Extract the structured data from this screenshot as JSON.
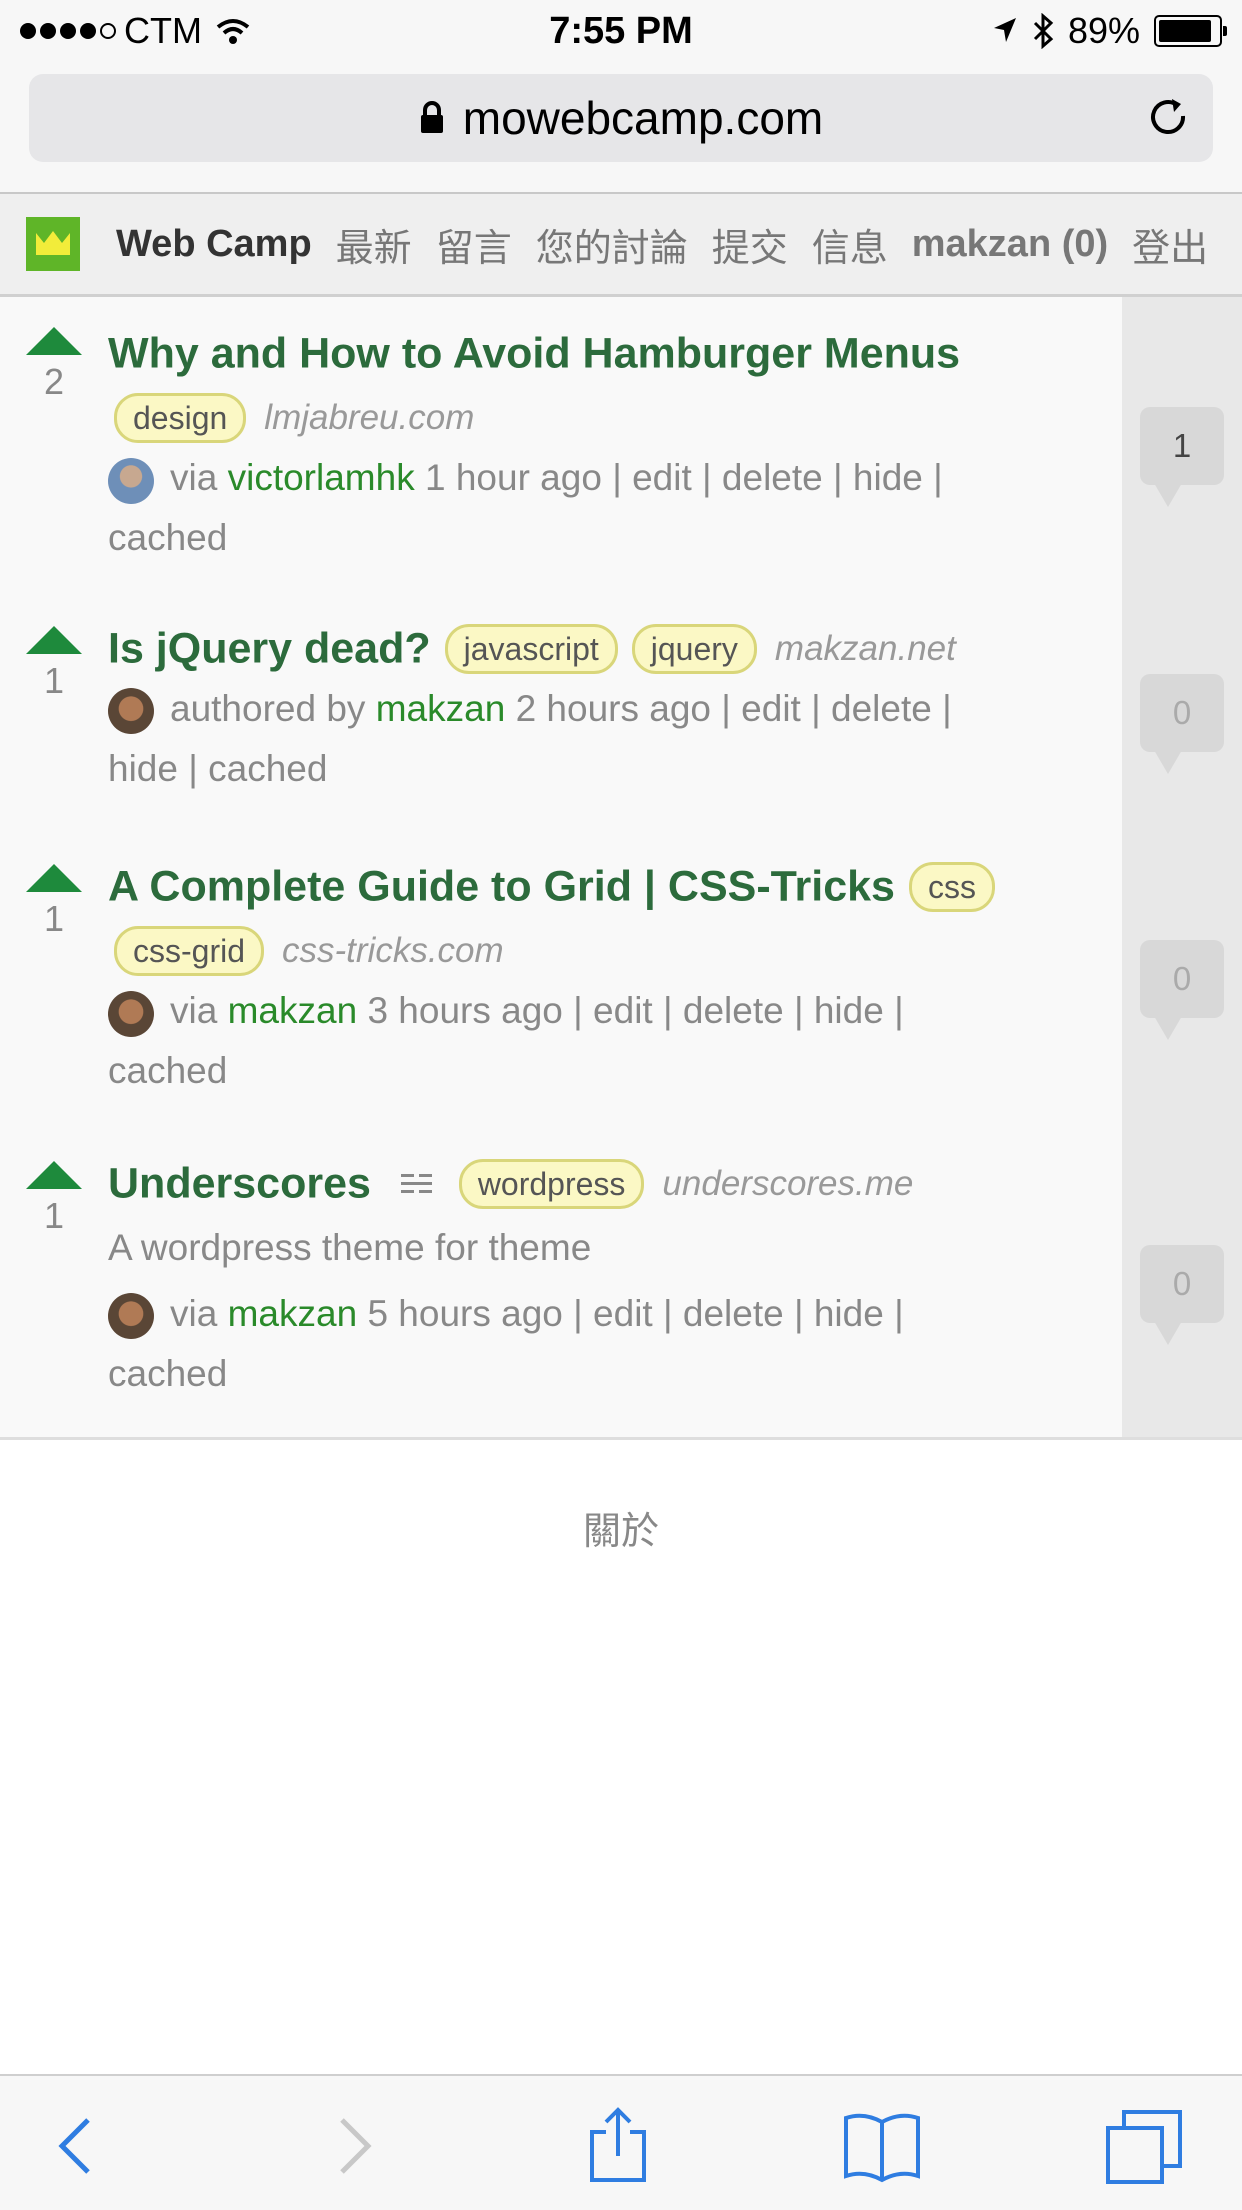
{
  "status_bar": {
    "carrier": "CTM",
    "time": "7:55 PM",
    "battery": "89%",
    "battery_level": 0.89
  },
  "browser": {
    "url": "mowebcamp.com"
  },
  "nav": {
    "site_title": "Web Camp",
    "items": [
      "最新",
      "留言",
      "您的討論",
      "提交",
      "信息"
    ],
    "user": "makzan (0)",
    "logout": "登出"
  },
  "stories": [
    {
      "votes": "2",
      "title": "Why and How to Avoid Hamburger Menus",
      "tags": [
        "design"
      ],
      "domain": "lmjabreu.com",
      "prefix": "via",
      "author": "victorlamhk",
      "time": "1 hour ago",
      "actions_a": "| edit | delete | hide |",
      "actions_b": "cached",
      "comments": "1"
    },
    {
      "votes": "1",
      "title": "Is jQuery dead?",
      "tags": [
        "javascript",
        "jquery"
      ],
      "domain": "makzan.net",
      "prefix": "authored by",
      "author": "makzan",
      "time": "2 hours ago",
      "actions_a": "| edit | delete |",
      "actions_b": "hide | cached",
      "comments": "0"
    },
    {
      "votes": "1",
      "title": "A Complete Guide to Grid | CSS-Tricks",
      "tags": [
        "css",
        "css-grid"
      ],
      "domain": "css-tricks.com",
      "prefix": "via",
      "author": "makzan",
      "time": "3 hours ago",
      "actions_a": "| edit | delete | hide |",
      "actions_b": "cached",
      "comments": "0"
    },
    {
      "votes": "1",
      "title": "Underscores",
      "tags": [
        "wordpress"
      ],
      "domain": "underscores.me",
      "description": "A wordpress theme for theme",
      "prefix": "via",
      "author": "makzan",
      "time": "5 hours ago",
      "actions_a": "| edit | delete | hide |",
      "actions_b": "cached",
      "comments": "0"
    }
  ],
  "footer": {
    "about": "關於"
  },
  "toolbar": {
    "icons": [
      "back-icon",
      "forward-icon",
      "share-icon",
      "bookmarks-icon",
      "tabs-icon"
    ]
  },
  "colors": {
    "title": "#2c6b3c",
    "author": "#2a8a2a",
    "vote_arrow": "#1e8a3c",
    "tag_bg": "#fbf8c5",
    "ios_blue": "#2f7de1"
  }
}
